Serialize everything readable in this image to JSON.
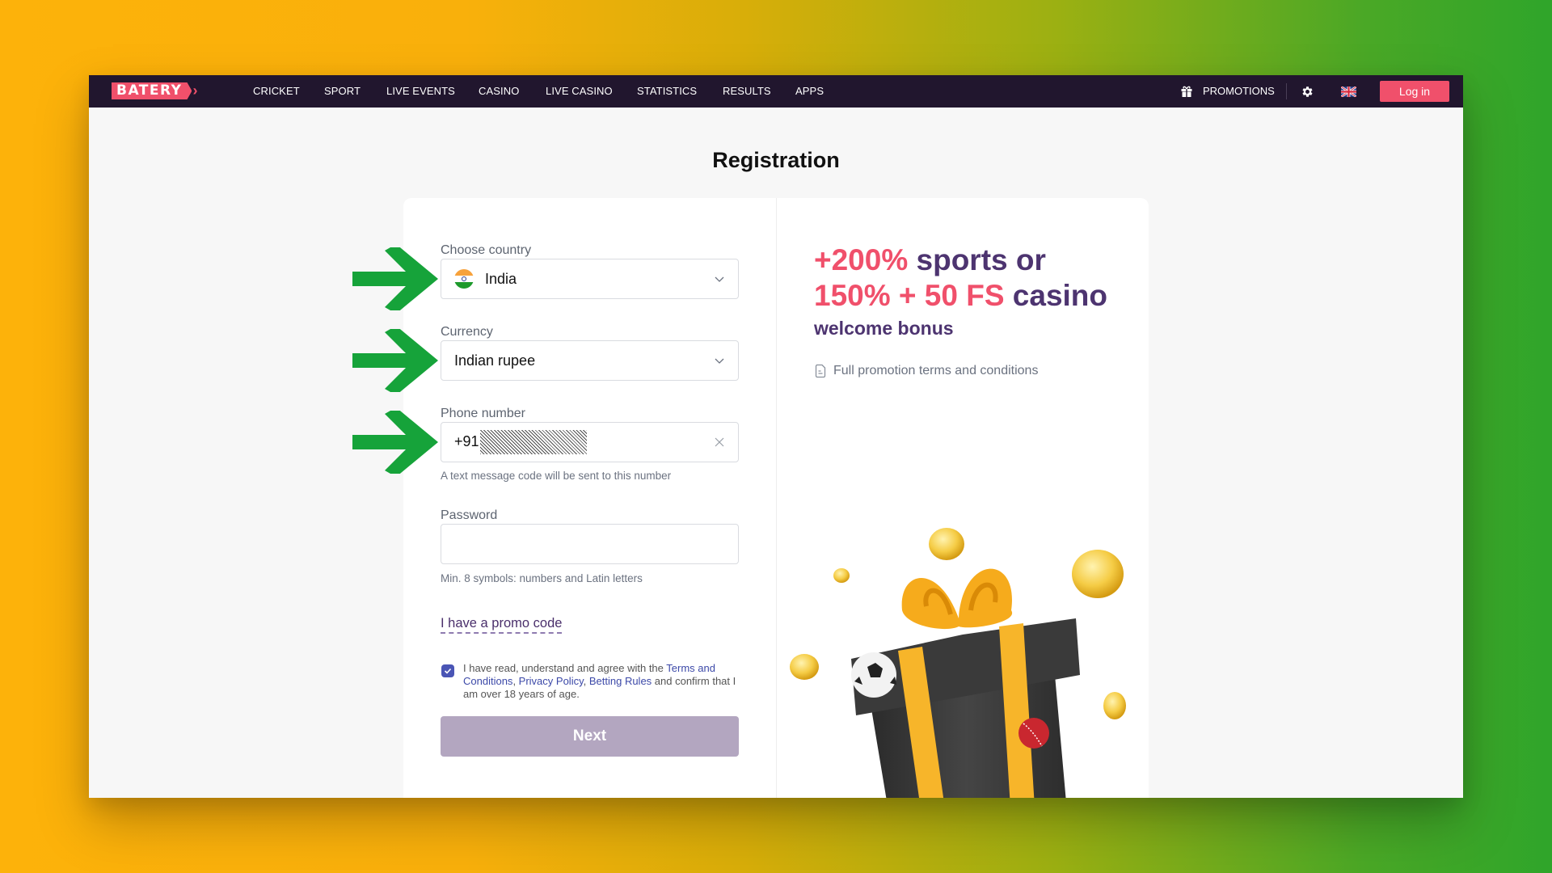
{
  "navbar": {
    "logo": "BATERY",
    "items": [
      {
        "label": "CRICKET"
      },
      {
        "label": "SPORT"
      },
      {
        "label": "LIVE EVENTS"
      },
      {
        "label": "CASINO"
      },
      {
        "label": "LIVE CASINO"
      },
      {
        "label": "STATISTICS"
      },
      {
        "label": "RESULTS"
      },
      {
        "label": "APPS"
      }
    ],
    "promotions_label": "PROMOTIONS",
    "settings_icon": "gear-icon",
    "language_flag": "uk-flag-icon",
    "login_label": "Log in"
  },
  "page": {
    "title": "Registration"
  },
  "form": {
    "country": {
      "label": "Choose country",
      "value": "India",
      "flag": "india-flag-icon"
    },
    "currency": {
      "label": "Currency",
      "value": "Indian rupee"
    },
    "phone": {
      "label": "Phone number",
      "value_prefix": "+91",
      "helper": "A text message code will be sent to this number"
    },
    "password": {
      "label": "Password",
      "value": "",
      "helper": "Min. 8 symbols: numbers and Latin letters"
    },
    "promo_link": "I have a promo code",
    "agreement": {
      "checked": true,
      "text_1": "I have read, understand and agree with the ",
      "link_terms": "Terms and Conditions",
      "sep_1": ", ",
      "link_privacy": "Privacy Policy",
      "sep_2": ", ",
      "link_rules": "Betting Rules",
      "text_2": " and confirm that I am over 18 years of age."
    },
    "next_label": "Next"
  },
  "promo": {
    "line1_highlight": "+200%",
    "line1_rest": " sports or",
    "line2_highlight": "150% + 50 FS",
    "line2_rest": " casino",
    "subhead": "welcome bonus",
    "terms_link": "Full promotion terms and conditions"
  },
  "colors": {
    "brand": "#f0506b",
    "navbar": "#21162e",
    "purple": "#4d3470",
    "next_disabled": "#b3a6c0",
    "annotation_arrow": "#16a33a"
  }
}
